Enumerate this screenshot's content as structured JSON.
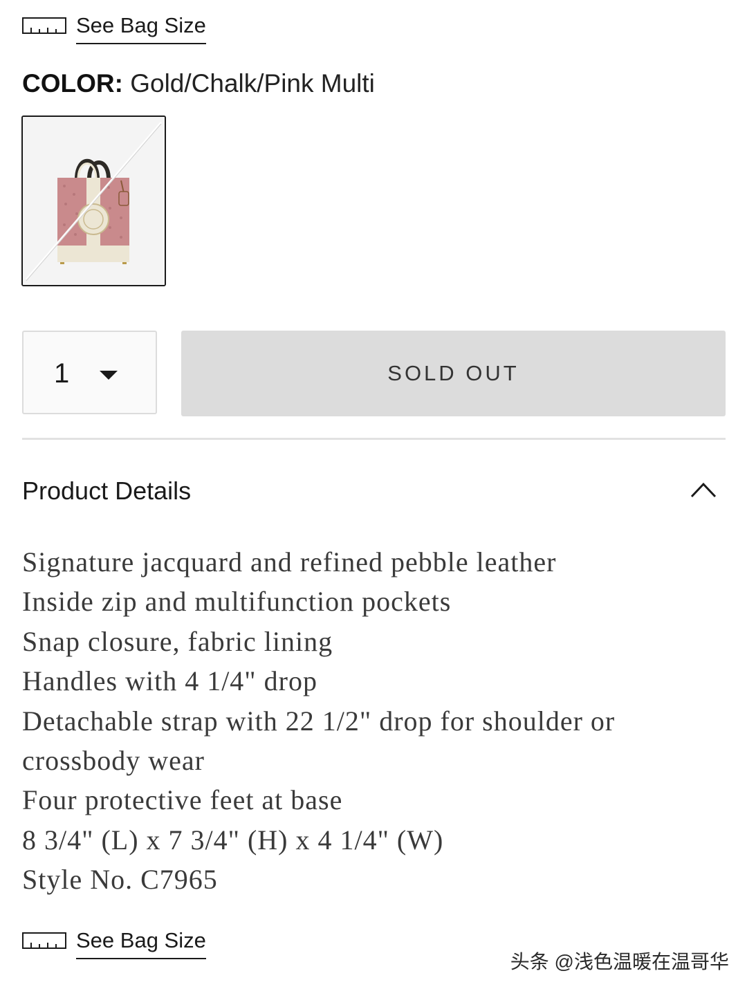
{
  "bag_size_top": {
    "label": "See Bag Size",
    "icon": "ruler-icon"
  },
  "color": {
    "key": "COLOR:",
    "value": "Gold/Chalk/Pink Multi"
  },
  "swatch": {
    "alt": "Gold/Chalk/Pink Multi tote swatch",
    "bag_pink": "#c98a8c",
    "bag_cream": "#ece6d4",
    "unavailable": true
  },
  "quantity": {
    "value": "1",
    "icon": "chevron-down-icon"
  },
  "sold_out_button": {
    "label": "SOLD OUT"
  },
  "product_details": {
    "title": "Product Details",
    "icon": "chevron-up-icon",
    "items": [
      "Signature jacquard and refined pebble leather",
      "Inside zip and multifunction pockets",
      "Snap closure, fabric lining",
      "Handles with 4 1/4\" drop",
      "Detachable strap with 22 1/2\" drop for shoulder or crossbody wear",
      "Four protective feet at base",
      "8 3/4\" (L) x 7 3/4\" (H) x 4 1/4\" (W)",
      "Style No. C7965"
    ]
  },
  "bag_size_bottom": {
    "label": "See Bag Size",
    "icon": "ruler-icon"
  },
  "watermark": "头条 @浅色温暖在温哥华"
}
